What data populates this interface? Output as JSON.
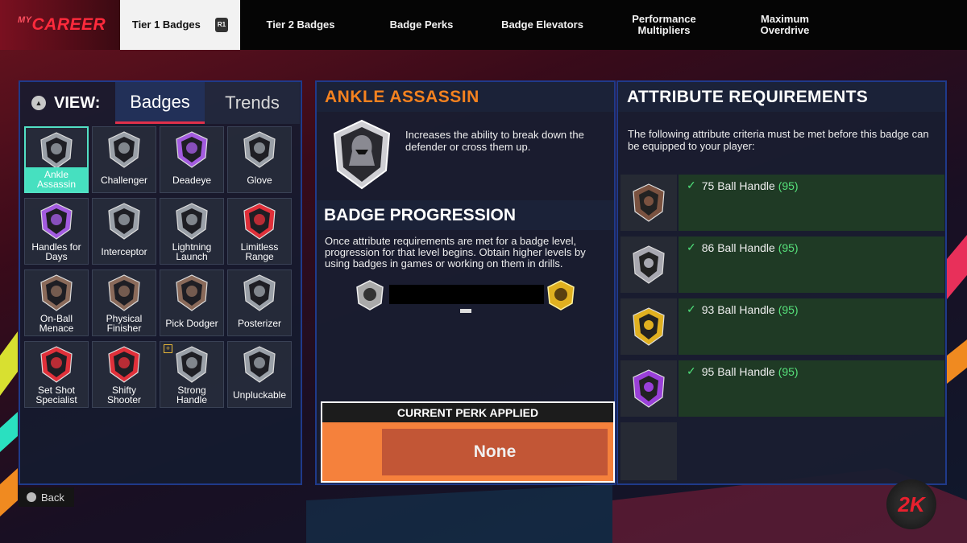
{
  "app": {
    "logo": "CAREER",
    "logo_prefix": "MY"
  },
  "nav": {
    "tabs": [
      {
        "label": "Tier 1 Badges",
        "hint": "R1",
        "active": true
      },
      {
        "label": "Tier 2 Badges"
      },
      {
        "label": "Badge Perks"
      },
      {
        "label": "Badge Elevators"
      },
      {
        "label": "Performance Multipliers"
      },
      {
        "label": "Maximum Overdrive"
      }
    ]
  },
  "view": {
    "label": "VIEW:",
    "tabs": [
      "Badges",
      "Trends"
    ],
    "selected": "Badges"
  },
  "badges": [
    {
      "name": "Ankle Assassin",
      "selected": true,
      "color": "#9aa0a8"
    },
    {
      "name": "Challenger",
      "color": "#9aa0a8"
    },
    {
      "name": "Deadeye",
      "color": "#a35be0"
    },
    {
      "name": "Glove",
      "color": "#9aa0a8"
    },
    {
      "name": "Handles for Days",
      "color": "#a35be0"
    },
    {
      "name": "Interceptor",
      "color": "#9aa0a8"
    },
    {
      "name": "Lightning Launch",
      "color": "#9aa0a8"
    },
    {
      "name": "Limitless Range",
      "color": "#e0303a"
    },
    {
      "name": "On-Ball Menace",
      "color": "#8a6a5a"
    },
    {
      "name": "Physical Finisher",
      "color": "#8a6a5a"
    },
    {
      "name": "Pick Dodger",
      "color": "#8a6a5a"
    },
    {
      "name": "Posterizer",
      "color": "#9aa0a8"
    },
    {
      "name": "Set Shot Specialist",
      "color": "#e0303a"
    },
    {
      "name": "Shifty Shooter",
      "color": "#e0303a"
    },
    {
      "name": "Strong Handle",
      "color": "#9aa0a8",
      "boosted": true
    },
    {
      "name": "Unpluckable",
      "color": "#9aa0a8"
    }
  ],
  "detail": {
    "title": "ANKLE ASSASSIN",
    "description": "Increases the ability to break down the defender or cross them up.",
    "progression_heading": "BADGE PROGRESSION",
    "progression_text": "Once attribute requirements are met for a badge level, progression for that level begins. Obtain higher levels by using badges in games or working on them in drills.",
    "perk_heading": "CURRENT PERK APPLIED",
    "perk_value": "None"
  },
  "requirements": {
    "title": "ATTRIBUTE REQUIREMENTS",
    "description": "The following attribute criteria must be met before this badge can be equipped to your player:",
    "levels": [
      {
        "text": "75 Ball Handle",
        "current": "(95)",
        "color": "#7a5240"
      },
      {
        "text": "86 Ball Handle",
        "current": "(95)",
        "color": "#a8a8b0"
      },
      {
        "text": "93 Ball Handle",
        "current": "(95)",
        "color": "#e0b020"
      },
      {
        "text": "95 Ball Handle",
        "current": "(95)",
        "color": "#9a40d8"
      }
    ]
  },
  "footer": {
    "back_label": "Back",
    "brand": "2K"
  },
  "colors": {
    "accent_orange": "#f5821f",
    "selected_teal": "#46e0c0",
    "panel_border": "#1f3a8a"
  }
}
